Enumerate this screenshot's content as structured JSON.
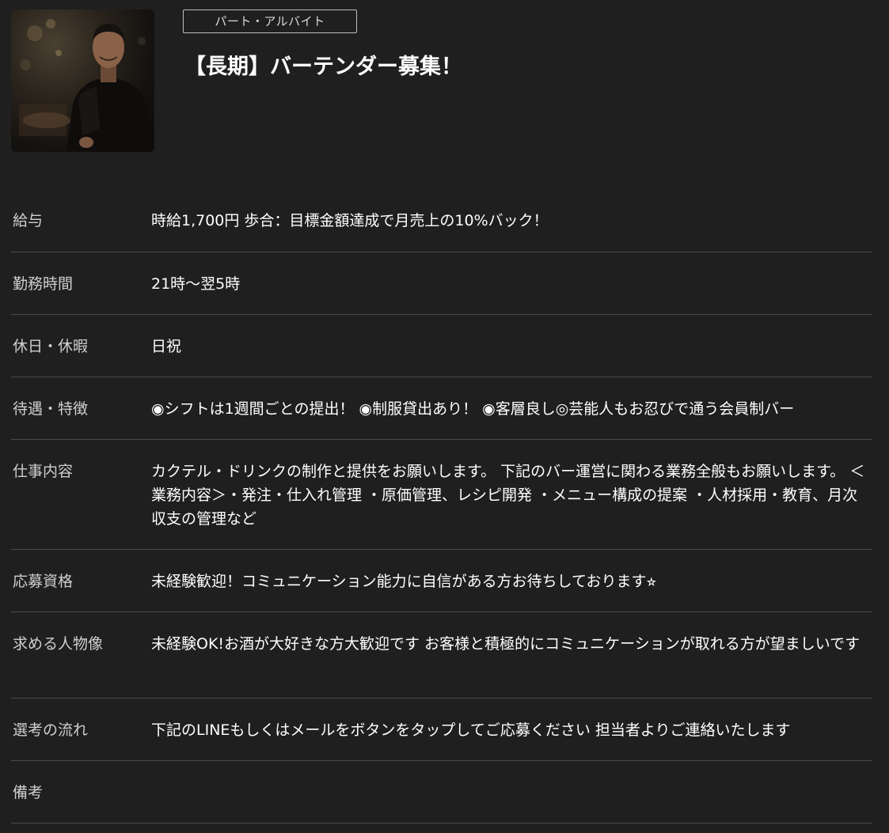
{
  "header": {
    "badge": "パート・アルバイト",
    "title": "【長期】バーテンダー募集！"
  },
  "details": [
    {
      "label": "給与",
      "value": "時給1,700円 歩合：目標金額達成で月売上の10%バック！"
    },
    {
      "label": "勤務時間",
      "value": "21時～翌5時"
    },
    {
      "label": "休日・休暇",
      "value": "日祝"
    },
    {
      "label": "待遇・特徴",
      "value": "◉シフトは1週間ごとの提出！ ◉制服貸出あり！ ◉客層良し◎芸能人もお忍びで通う会員制バー"
    },
    {
      "label": "仕事内容",
      "value": "カクテル・ドリンクの制作と提供をお願いします。 下記のバー運営に関わる業務全般もお願いします。 ＜業務内容＞・発注・仕入れ管理 ・原価管理、レシピ開発 ・メニュー構成の提案 ・人材採用・教育、月次収支の管理など"
    },
    {
      "label": "応募資格",
      "value": "未経験歓迎！コミュニケーション能力に自信がある方お待ちしております⭐︎"
    },
    {
      "label": "求める人物像",
      "value": "未経験OK!お酒が大好きな方大歓迎です お客様と積極的にコミュニケーションが取れる方が望ましいです"
    },
    {
      "label": "選考の流れ",
      "value": "下記のLINEもしくはメールをボタンをタップしてご応募ください 担当者よりご連絡いたします"
    },
    {
      "label": "備考",
      "value": ""
    }
  ]
}
